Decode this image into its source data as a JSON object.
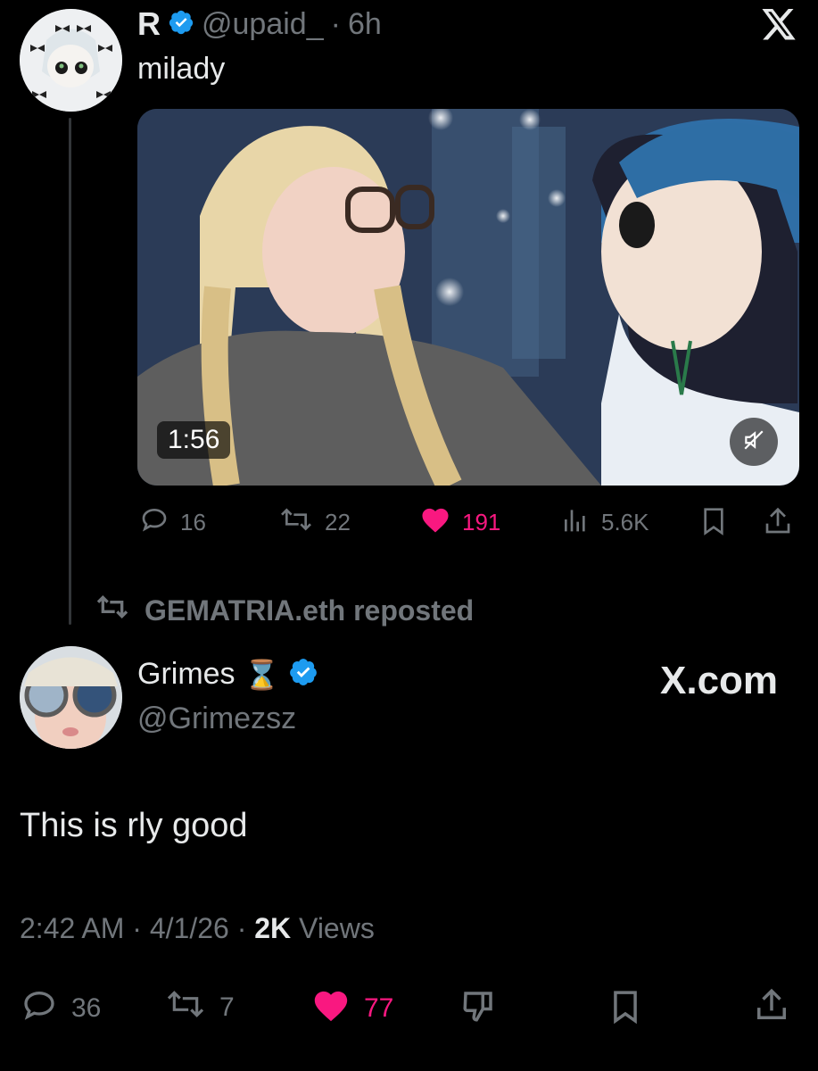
{
  "post1": {
    "name": "R",
    "handle": "@upaid_",
    "separator": "·",
    "time": "6h",
    "text": "milady",
    "video_duration": "1:56",
    "actions": {
      "replies": "16",
      "reposts": "22",
      "likes": "191",
      "views": "5.6K"
    }
  },
  "repost_banner": {
    "text": "GEMATRIA.eth reposted"
  },
  "post2": {
    "name": "Grimes",
    "emoji": "⌛",
    "handle": "@Grimezsz",
    "site_label": "X.com",
    "text": "This is rly good",
    "time": "2:42 AM",
    "date": "4/1/26",
    "views_count": "2K",
    "views_label": "Views",
    "actions": {
      "replies": "36",
      "reposts": "7",
      "likes": "77"
    }
  },
  "colors": {
    "background": "#000000",
    "primary_text": "#e7e9ea",
    "secondary_text": "#71767b",
    "like_pink": "#f91880",
    "verified_blue": "#1d9bf0"
  },
  "icons": [
    "x-logo-icon",
    "verified-badge-icon",
    "reply-icon",
    "repost-icon",
    "heart-icon",
    "views-icon",
    "bookmark-icon",
    "share-icon",
    "mute-icon",
    "dislike-icon",
    "hourglass-icon"
  ]
}
